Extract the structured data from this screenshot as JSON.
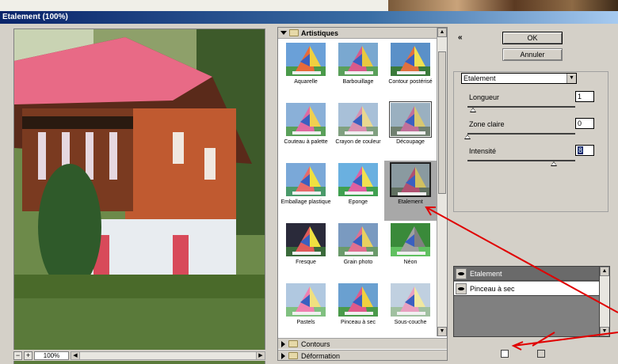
{
  "window": {
    "title": "Etalement (100%)"
  },
  "preview": {
    "zoom": "100%",
    "zoom_out": "−",
    "zoom_in": "+"
  },
  "gallery": {
    "category_open": "Artistiques",
    "filters": [
      {
        "label": "Aquarelle"
      },
      {
        "label": "Barbouillage"
      },
      {
        "label": "Contour postérisé"
      },
      {
        "label": "Couteau à palette"
      },
      {
        "label": "Crayon de couleur"
      },
      {
        "label": "Découpage"
      },
      {
        "label": "Emballage plastique"
      },
      {
        "label": "Eponge"
      },
      {
        "label": "Etalement"
      },
      {
        "label": "Fresque"
      },
      {
        "label": "Grain photo"
      },
      {
        "label": "Néon"
      },
      {
        "label": "Pastels"
      },
      {
        "label": "Pinceau à sec"
      },
      {
        "label": "Sous-couche"
      }
    ],
    "selected": "Etalement",
    "categories_closed": [
      "Contours",
      "Déformation"
    ]
  },
  "buttons": {
    "ok": "OK",
    "cancel": "Annuler"
  },
  "settings": {
    "filter": "Etalement",
    "params": [
      {
        "label": "Longueur",
        "value": "1",
        "level": 0.05
      },
      {
        "label": "Zone claire",
        "value": "0",
        "level": 0.0
      },
      {
        "label": "Intensité",
        "value": "8",
        "level": 0.8
      }
    ]
  },
  "layers": [
    {
      "label": "Etalement",
      "active": true
    },
    {
      "label": "Pinceau à sec",
      "active": false
    }
  ],
  "colors": {
    "annotation_arrow": "#e00000",
    "title_bar": "#0a246a",
    "dialog_bg": "#d4d0c8"
  }
}
